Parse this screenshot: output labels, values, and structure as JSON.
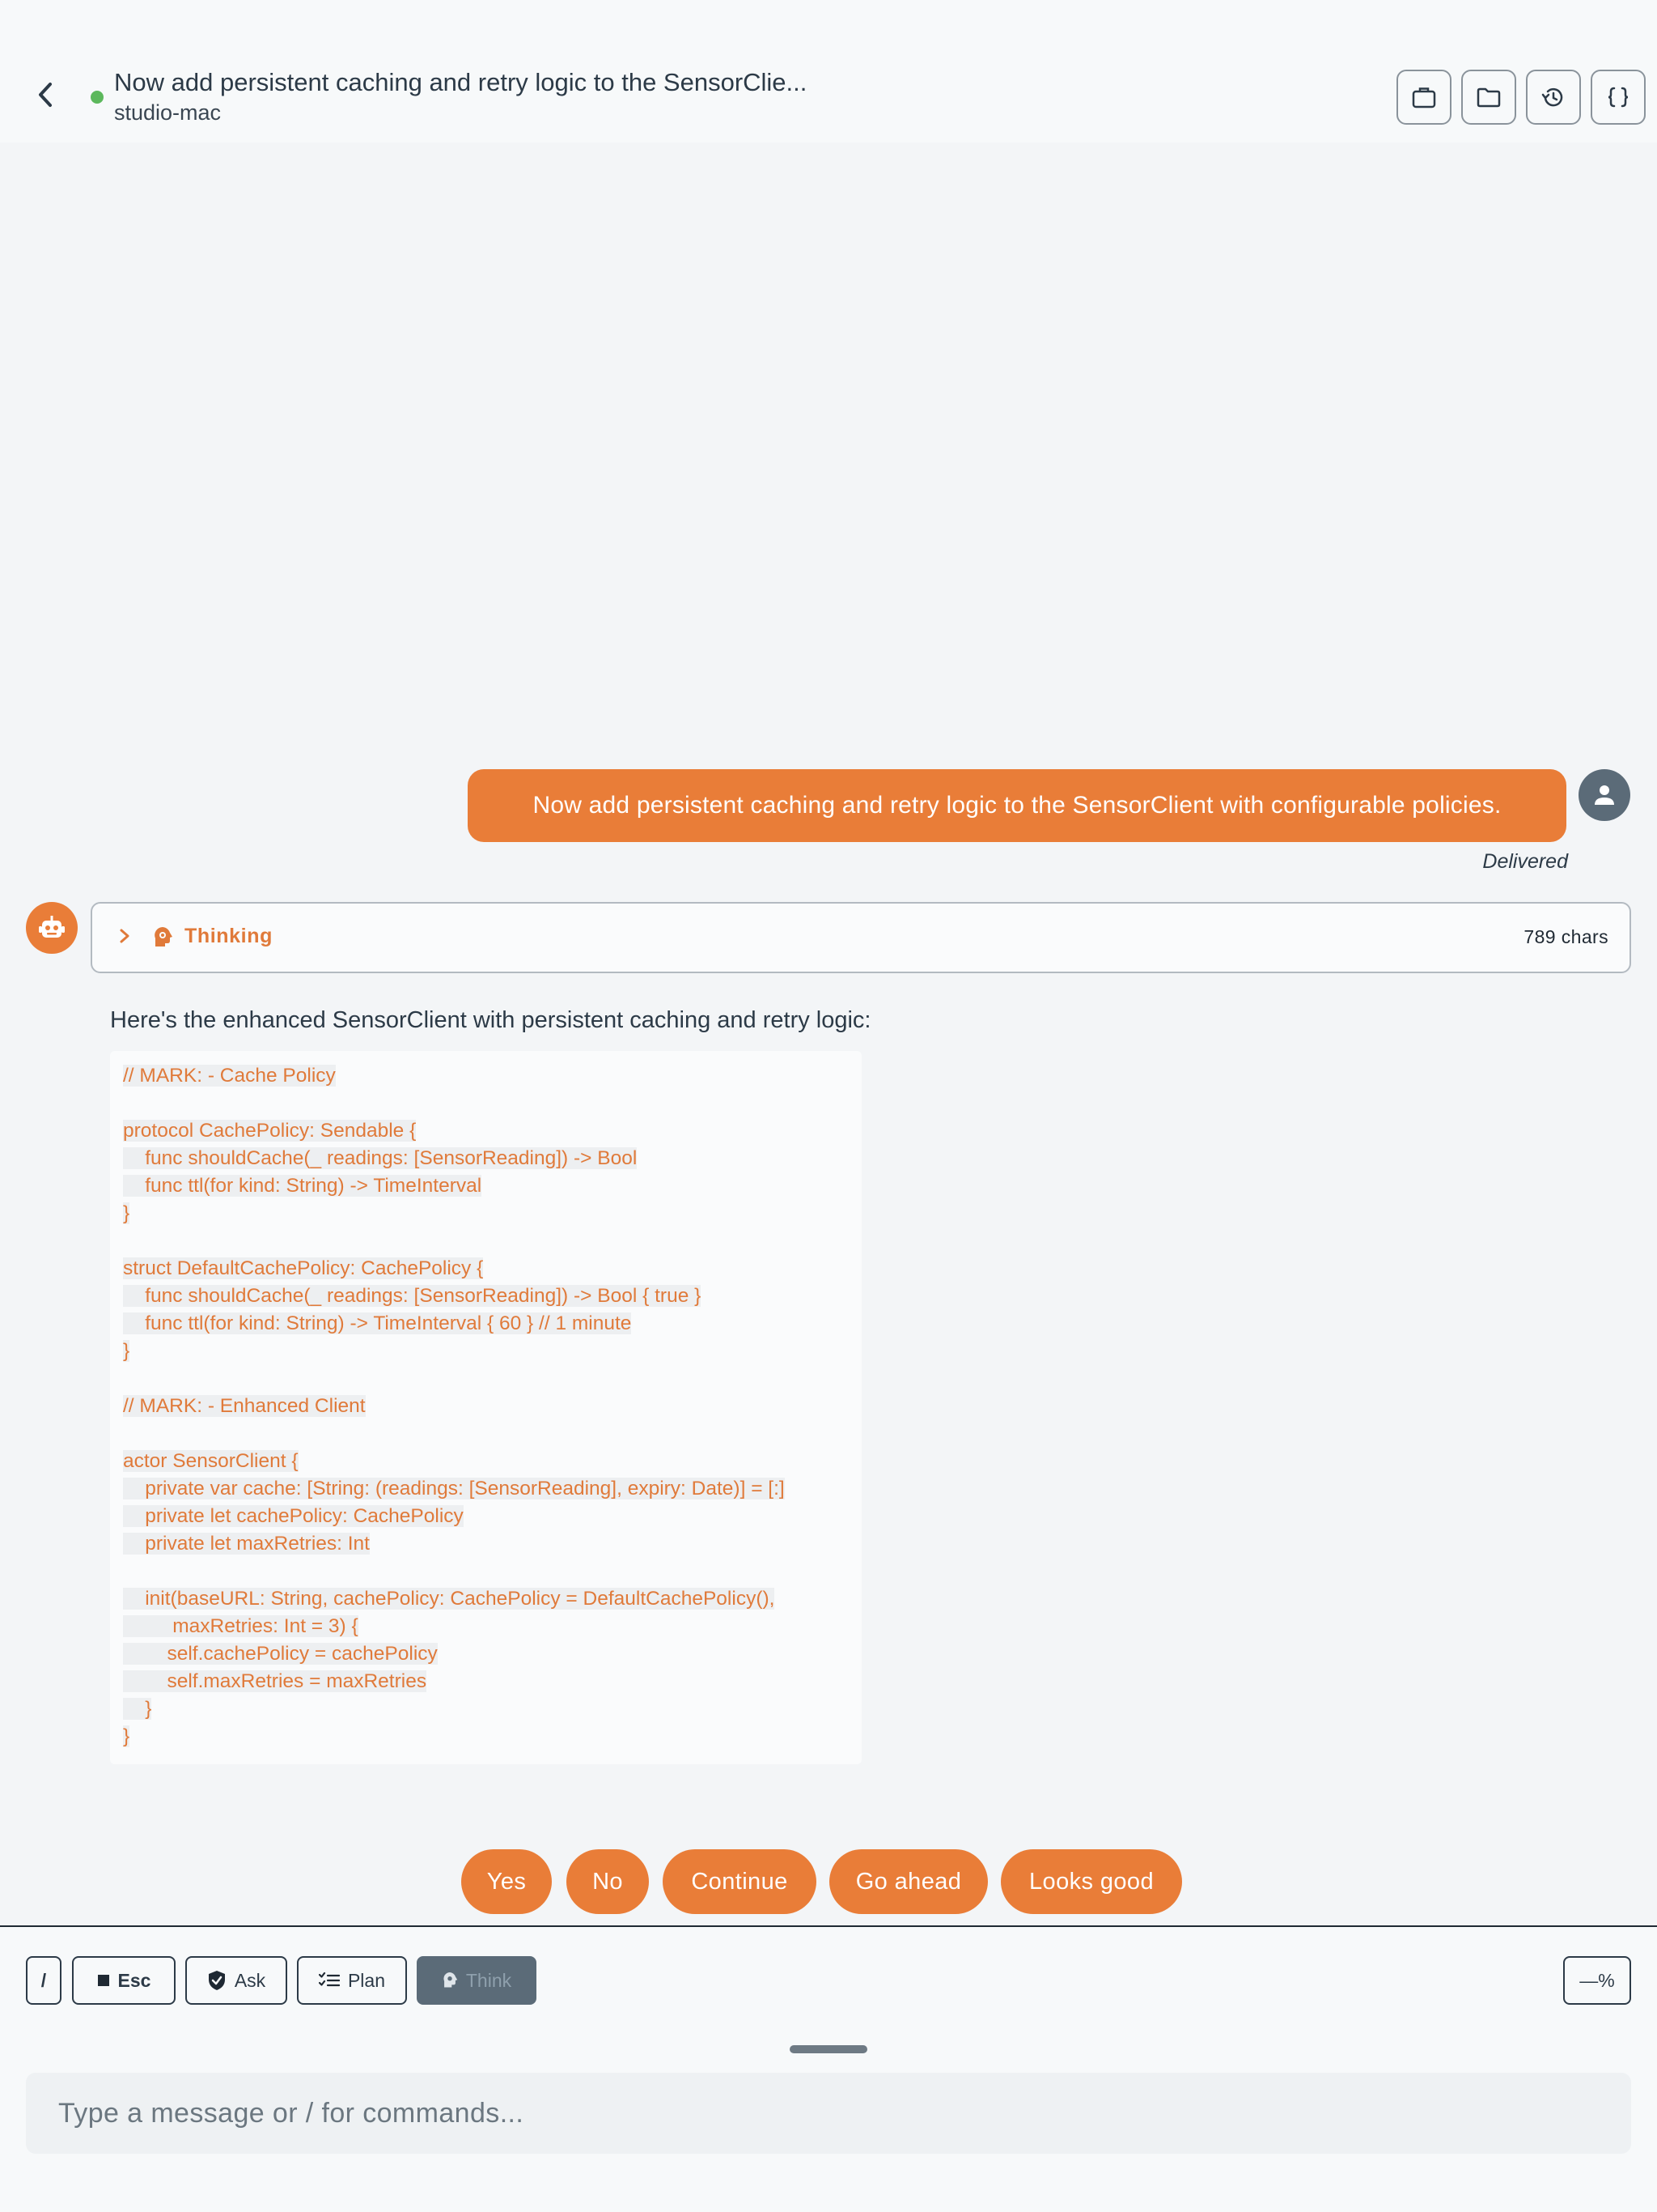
{
  "header": {
    "title": "Now add persistent caching and retry logic to the SensorClie...",
    "subtitle": "studio-mac",
    "status_color": "#5cb85c",
    "actions": [
      "briefcase-icon",
      "folder-icon",
      "history-icon",
      "braces-icon"
    ]
  },
  "chat": {
    "user_message": "Now add persistent caching and retry logic to the SensorClient with configurable policies.",
    "delivery_status": "Delivered",
    "thinking_label": "Thinking",
    "thinking_count": "789 chars",
    "reply_intro": "Here's the enhanced SensorClient with persistent caching and retry logic:",
    "code_lines": [
      "// MARK: - Cache Policy",
      "",
      "protocol CachePolicy: Sendable {",
      "    func shouldCache(_ readings: [SensorReading]) -> Bool",
      "    func ttl(for kind: String) -> TimeInterval",
      "}",
      "",
      "struct DefaultCachePolicy: CachePolicy {",
      "    func shouldCache(_ readings: [SensorReading]) -> Bool { true }",
      "    func ttl(for kind: String) -> TimeInterval { 60 } // 1 minute",
      "}",
      "",
      "// MARK: - Enhanced Client",
      "",
      "actor SensorClient {",
      "    private var cache: [String: (readings: [SensorReading], expiry: Date)] = [:]",
      "    private let cachePolicy: CachePolicy",
      "    private let maxRetries: Int",
      "",
      "    init(baseURL: String, cachePolicy: CachePolicy = DefaultCachePolicy(),",
      "         maxRetries: Int = 3) {",
      "        self.cachePolicy = cachePolicy",
      "        self.maxRetries = maxRetries",
      "    }",
      "}"
    ]
  },
  "quick_replies": [
    "Yes",
    "No",
    "Continue",
    "Go ahead",
    "Looks good"
  ],
  "toolbar": {
    "slash_label": "/",
    "esc_label": "Esc",
    "ask_label": "Ask",
    "plan_label": "Plan",
    "think_label": "Think",
    "percent_label": "—%"
  },
  "composer": {
    "placeholder": "Type a message or / for commands..."
  },
  "colors": {
    "accent": "#e97d38",
    "avatar": "#5b6b78",
    "background": "#f3f5f7"
  }
}
